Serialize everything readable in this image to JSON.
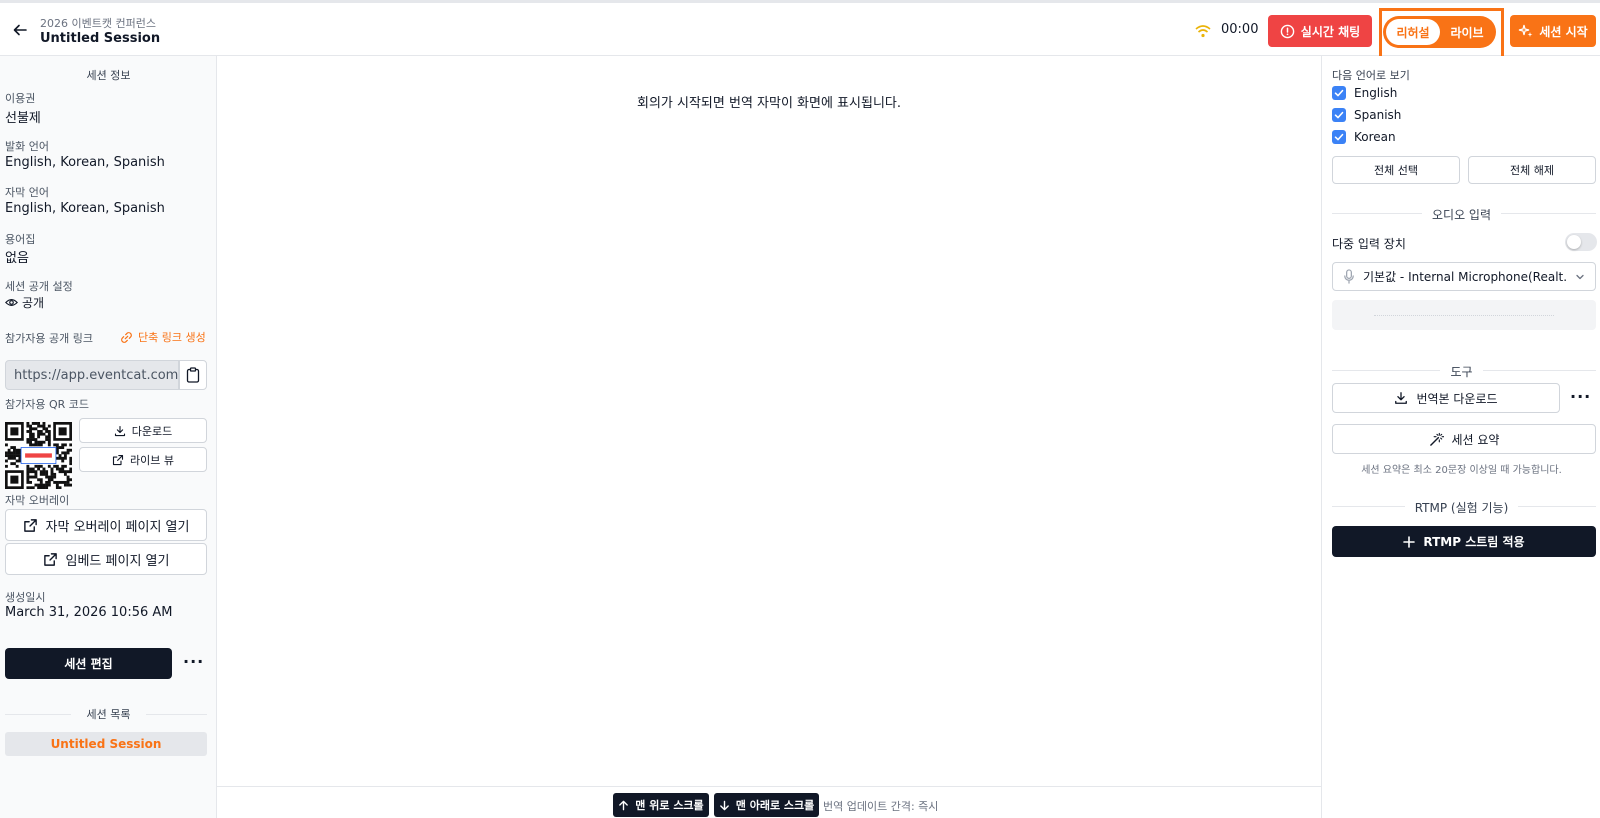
{
  "header": {
    "subtitle": "2026 이벤트캣 컨퍼런스",
    "title": "Untitled Session",
    "timer": "00:00",
    "chat_label": "실시간 채팅",
    "mode_rehearsal": "리허설",
    "mode_live": "라이브",
    "start_label": "세션 시작",
    "colors": {
      "accent": "#f97316",
      "danger": "#ef4444",
      "dark": "#111827"
    }
  },
  "left": {
    "section_title": "세션 정보",
    "plan_label": "이용권",
    "plan_value": "선불제",
    "speech_lang_label": "발화 언어",
    "speech_lang_value": "English, Korean, Spanish",
    "caption_lang_label": "자막 언어",
    "caption_lang_value": "English, Korean, Spanish",
    "glossary_label": "용어집",
    "glossary_value": "없음",
    "visibility_label": "세션 공개 설정",
    "visibility_value": "공개",
    "public_link_label": "참가자용 공개 링크",
    "short_link_label": "단축 링크 생성",
    "public_link_value": "https://app.eventcat.com/se",
    "qr_label": "참가자용 QR 코드",
    "download_label": "다운로드",
    "live_view_label": "라이브 뷰",
    "overlay_label": "자막 오버레이",
    "overlay_open_label": "자막 오버레이 페이지 열기",
    "embed_open_label": "임베드 페이지 열기",
    "created_label": "생성일시",
    "created_value": "March 31, 2026 10:56 AM",
    "edit_label": "세션 편집",
    "more_label": "···",
    "list_title": "세션 목록",
    "list_items": [
      "Untitled Session"
    ]
  },
  "main": {
    "placeholder": "회의가 시작되면 번역 자막이 화면에 표시됩니다.",
    "scroll_top_label": "맨 위로 스크롤",
    "scroll_bottom_label": "맨 아래로 스크롤",
    "interval_text": "번역 업데이트 간격: 즉시"
  },
  "right": {
    "view_lang_label": "다음 언어로 보기",
    "languages": [
      "English",
      "Spanish",
      "Korean"
    ],
    "select_all_label": "전체 선택",
    "deselect_all_label": "전체 해제",
    "audio_title": "오디오 입력",
    "multi_input_label": "다중 입력 장치",
    "mic_value": "기본값 - Internal Microphone(Realt...",
    "tools_title": "도구",
    "download_transcript_label": "번역본 다운로드",
    "more_label": "···",
    "summary_label": "세션 요약",
    "summary_note": "세션 요약은 최소 20문장 이상일 때 가능합니다.",
    "rtmp_title": "RTMP (실험 기능)",
    "rtmp_button_label": "RTMP 스트림 적용"
  }
}
